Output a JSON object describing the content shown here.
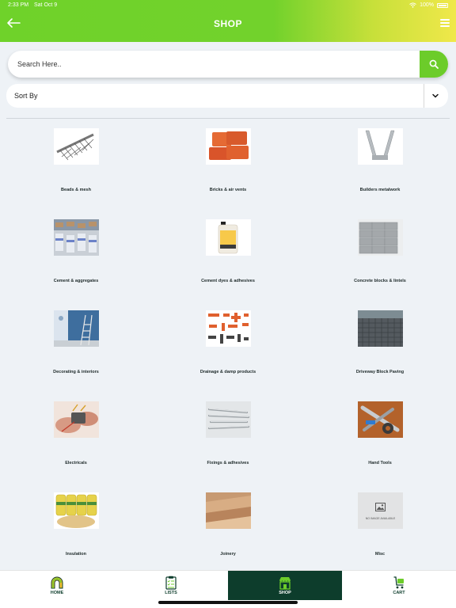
{
  "status_bar": {
    "time": "2:33 PM",
    "date": "Sat Oct 9",
    "battery": "100%"
  },
  "header": {
    "title": "SHOP"
  },
  "search": {
    "placeholder": "Search Here.."
  },
  "sort": {
    "label": "Sort By"
  },
  "categories": [
    {
      "label": "Beads & mesh",
      "icon": "beads-mesh-image"
    },
    {
      "label": "Bricks & air vents",
      "icon": "bricks-image"
    },
    {
      "label": "Builders metalwork",
      "icon": "metalwork-image"
    },
    {
      "label": "Cement & aggregates",
      "icon": "cement-image"
    },
    {
      "label": "Cement dyes & adhesives",
      "icon": "cement-dye-image"
    },
    {
      "label": "Concrete blocks & lintels",
      "icon": "concrete-blocks-image"
    },
    {
      "label": "Decorating & interiors",
      "icon": "decorating-image"
    },
    {
      "label": "Drainage & damp products",
      "icon": "drainage-image"
    },
    {
      "label": "Driveway Block Paving",
      "icon": "paving-image"
    },
    {
      "label": "Electricals",
      "icon": "electricals-image"
    },
    {
      "label": "Fixings & adhesives",
      "icon": "fixings-image"
    },
    {
      "label": "Hand Tools",
      "icon": "hand-tools-image"
    },
    {
      "label": "Insulation",
      "icon": "insulation-image"
    },
    {
      "label": "Joinery",
      "icon": "joinery-image"
    },
    {
      "label": "Misc",
      "icon": "no-image-placeholder",
      "placeholder_text": "NO IMAGE AVAILABLE"
    }
  ],
  "nav": {
    "items": [
      {
        "label": "HOME",
        "icon": "home-icon"
      },
      {
        "label": "LISTS",
        "icon": "clipboard-icon"
      },
      {
        "label": "SHOP",
        "icon": "shop-icon"
      },
      {
        "label": "CART",
        "icon": "cart-icon"
      }
    ],
    "active": "SHOP"
  },
  "colors": {
    "brand_green": "#6ccc2a",
    "dark_green": "#0d3d2c",
    "background": "#eef2f6"
  }
}
